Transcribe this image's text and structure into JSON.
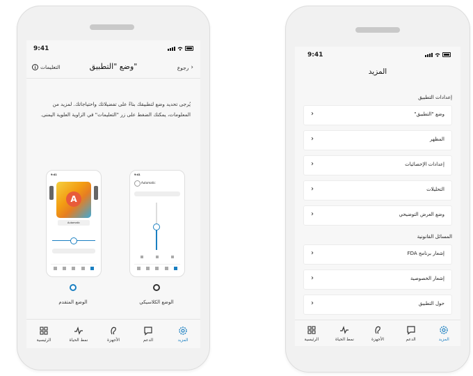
{
  "left_screen": {
    "time": "9:41",
    "title": "وضع \"التطبيق\"",
    "info_label": "التعليمات",
    "back_label": "رجوع",
    "description": "يُرجى تحديد وضع لتطبيقك بناءً على تفضيلاتك واحتياجاتك. لمزيد من المعلومات، يمكنك الضغط على زر \"التعليمات\" في الزاوية العلوية اليمنى.",
    "modes": [
      {
        "label": "الوضع المتقدم",
        "selected": true
      },
      {
        "label": "الوضع الكلاسيكي",
        "selected": false
      }
    ],
    "advanced_preview": {
      "program_letter": "A",
      "program_label": "Automatic"
    },
    "classic_preview": {
      "program_label": "Automatic"
    }
  },
  "right_screen": {
    "time": "9:41",
    "title": "المزيد",
    "sections": [
      {
        "heading": "إعدادات التطبيق",
        "items": [
          "وضع \"التطبيق\"",
          "المظهر",
          "إعدادات الإحصائيات",
          "التحليلات",
          "وضع العرض التوضيحي"
        ]
      },
      {
        "heading": "المسائل القانونية",
        "items": [
          "إشعار برنامج FDA",
          "إشعار الخصوصية",
          "حول التطبيق"
        ]
      }
    ]
  },
  "tabbar": {
    "tabs": [
      {
        "label": "المزيد",
        "icon": "gear-icon",
        "active": true
      },
      {
        "label": "الدعم",
        "icon": "chat-bubble-icon",
        "active": false
      },
      {
        "label": "الأجهزة",
        "icon": "hearing-aid-icon",
        "active": false
      },
      {
        "label": "نمط الحياة",
        "icon": "activity-icon",
        "active": false
      },
      {
        "label": "الرئيسية",
        "icon": "grid-icon",
        "active": false
      }
    ]
  },
  "colors": {
    "accent": "#1a7fc1",
    "background": "#f7f7f7"
  }
}
